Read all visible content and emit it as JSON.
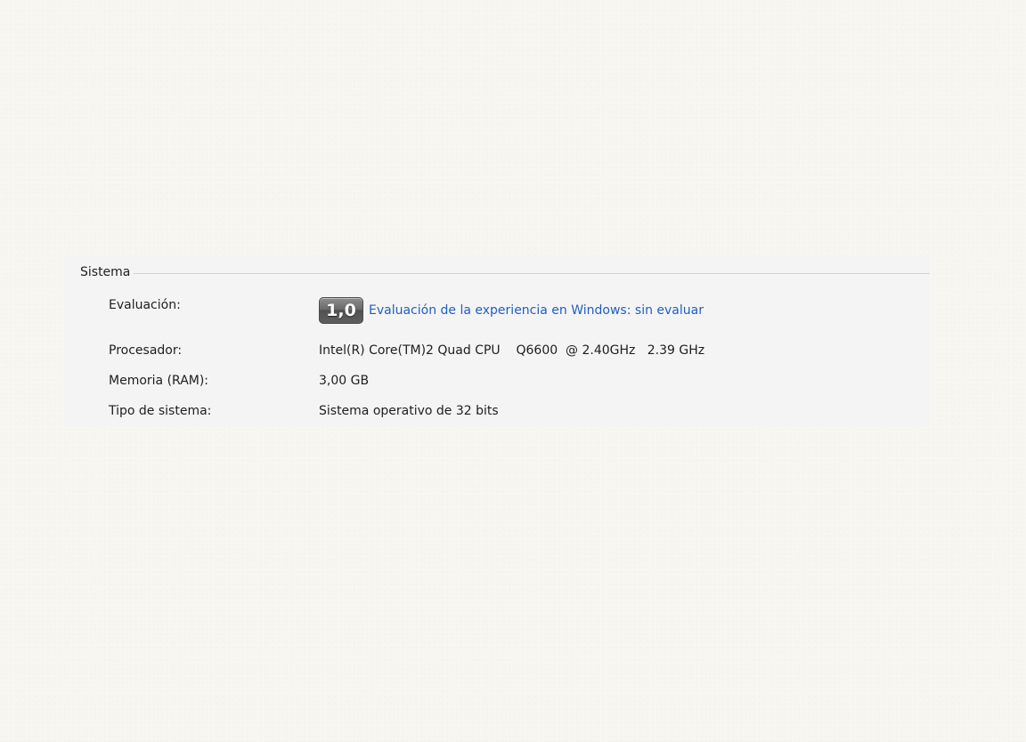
{
  "system": {
    "title": "Sistema",
    "rating": {
      "label": "Evaluación:",
      "score": "1,0",
      "link_text": "Evaluación de la experiencia en Windows: sin evaluar"
    },
    "processor": {
      "label": "Procesador:",
      "value": "Intel(R) Core(TM)2 Quad CPU    Q6600  @ 2.40GHz   2.39 GHz"
    },
    "memory": {
      "label": "Memoria (RAM):",
      "value": "3,00 GB"
    },
    "system_type": {
      "label": "Tipo de sistema:",
      "value": "Sistema operativo de 32 bits"
    }
  },
  "colors": {
    "background": "#f7f6f0",
    "panel": "#f4f4f4",
    "link": "#1f5fbf",
    "badge": "#6b6b6b"
  }
}
